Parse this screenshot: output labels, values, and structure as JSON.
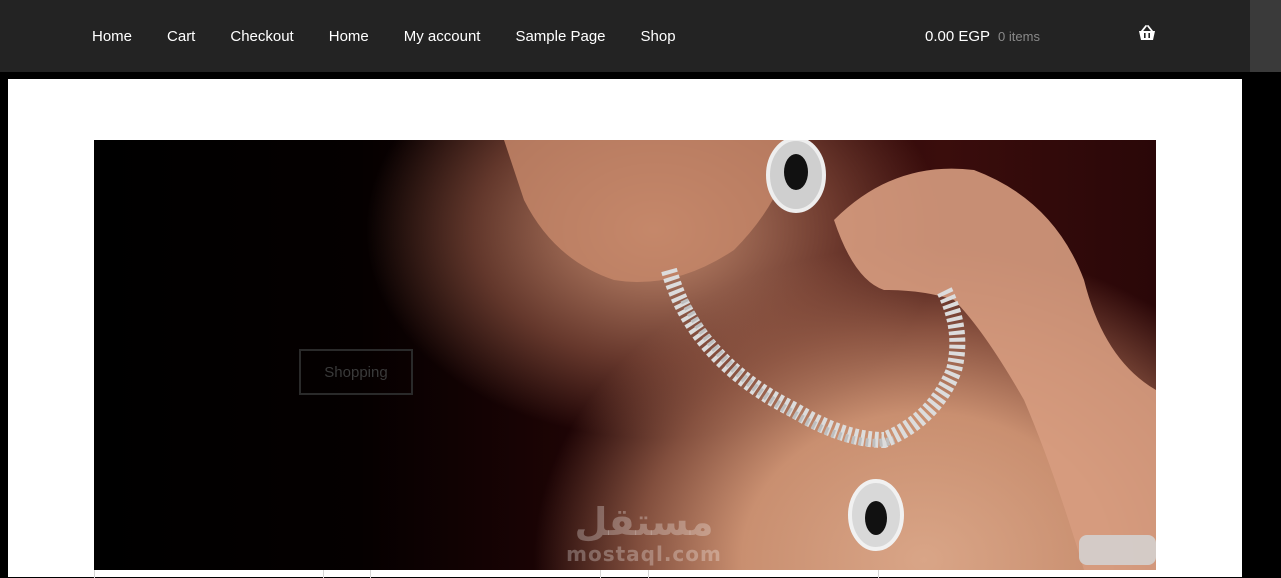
{
  "nav": {
    "items": [
      {
        "label": "Home"
      },
      {
        "label": "Cart"
      },
      {
        "label": "Checkout"
      },
      {
        "label": "Home"
      },
      {
        "label": "My account"
      },
      {
        "label": "Sample Page"
      },
      {
        "label": "Shop"
      }
    ]
  },
  "cart": {
    "amount": "0.00 EGP",
    "count": "0 items",
    "icon": "basket-icon"
  },
  "hero": {
    "button_label": "Shopping",
    "image": "jewelry-model-necklace-earring"
  },
  "watermark": {
    "arabic": "مستقل",
    "latin": "mostaql.com"
  },
  "colors": {
    "topbar": "#232323",
    "nav_text": "#ffffff",
    "muted_text": "#8a8a8a"
  }
}
